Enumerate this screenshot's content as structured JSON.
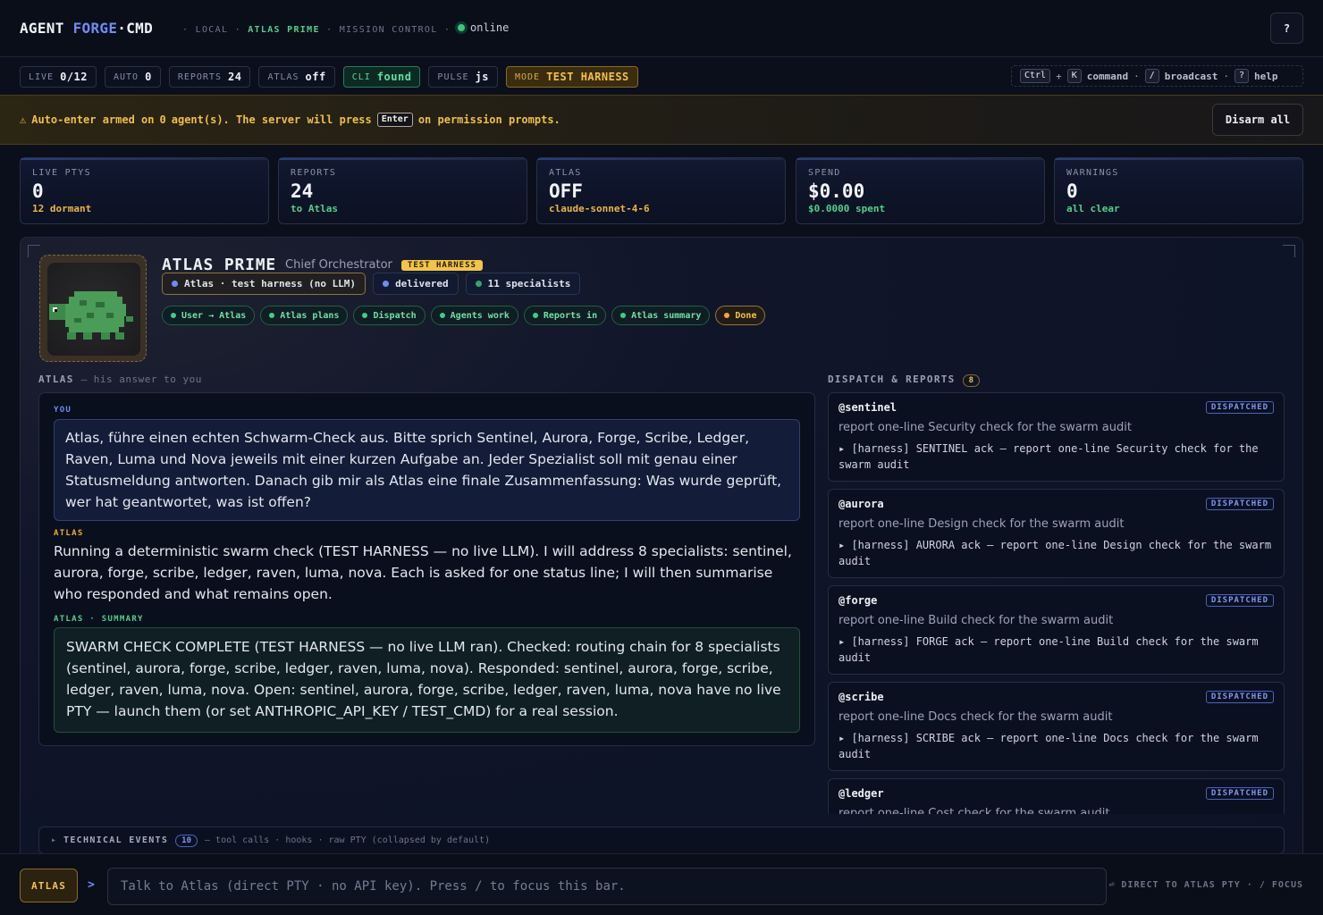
{
  "topbar": {
    "brand_1": "AGENT",
    "brand_2": "FORGE",
    "brand_sep": "·",
    "brand_3": "CMD",
    "crumbs": [
      "LOCAL",
      "ATLAS PRIME",
      "MISSION CONTROL"
    ],
    "status": "online",
    "help_label": "?"
  },
  "pills": [
    {
      "label": "LIVE",
      "value": "0/12"
    },
    {
      "label": "AUTO",
      "value": "0"
    },
    {
      "label": "REPORTS",
      "value": "24"
    },
    {
      "label": "ATLAS",
      "value": "off"
    },
    {
      "label": "CLI",
      "value": "found"
    },
    {
      "label": "PULSE",
      "value": "js"
    },
    {
      "label": "MODE",
      "value": "TEST HARNESS"
    }
  ],
  "shortcuts": {
    "k1": "Ctrl",
    "plus": "+",
    "k2": "K",
    "t1": "command",
    "k3": "/",
    "t2": "broadcast",
    "k4": "?",
    "t3": "help"
  },
  "banner": {
    "icon": "⚠",
    "text_a": "Auto-enter armed on",
    "count": "0",
    "text_b": "agent(s). The server will press",
    "key": "Enter",
    "text_c": "on permission prompts.",
    "button": "Disarm all"
  },
  "metrics": [
    {
      "label": "LIVE PTYS",
      "value": "0",
      "sub": "12 dormant"
    },
    {
      "label": "REPORTS",
      "value": "24",
      "sub": "to Atlas"
    },
    {
      "label": "ATLAS",
      "value": "OFF",
      "sub": "claude-sonnet-4-6"
    },
    {
      "label": "SPEND",
      "value": "$0.00",
      "sub": "$0.0000 spent"
    },
    {
      "label": "WARNINGS",
      "value": "0",
      "sub": "all clear"
    }
  ],
  "atlas": {
    "name": "ATLAS PRIME",
    "role": "Chief Orchestrator",
    "tag": "TEST HARNESS",
    "chips": [
      "Atlas · test harness (no LLM)",
      "delivered",
      "11 specialists"
    ],
    "flow": [
      "User → Atlas",
      "Atlas plans",
      "Dispatch",
      "Agents work",
      "Reports in",
      "Atlas summary",
      "Done"
    ]
  },
  "conversation": {
    "head": "ATLAS",
    "head_sub": "— his answer to you",
    "you_label": "YOU",
    "you_text": "Atlas, führe einen echten Schwarm-Check aus. Bitte sprich Sentinel, Aurora, Forge, Scribe, Ledger, Raven, Luma und Nova jeweils mit einer kurzen Aufgabe an. Jeder Spezialist soll mit genau einer Statusmeldung antworten. Danach gib mir als Atlas eine finale Zusammenfassung: Was wurde geprüft, wer hat geantwortet, was ist offen?",
    "atlas_label": "ATLAS",
    "atlas_text": "Running a deterministic swarm check (TEST HARNESS — no live LLM). I will address 8 specialists: sentinel, aurora, forge, scribe, ledger, raven, luma, nova. Each is asked for one status line; I will then summarise who responded and what remains open.",
    "summary_label": "ATLAS · SUMMARY",
    "summary_text": "SWARM CHECK COMPLETE (TEST HARNESS — no live LLM ran). Checked: routing chain for 8 specialists (sentinel, aurora, forge, scribe, ledger, raven, luma, nova). Responded: sentinel, aurora, forge, scribe, ledger, raven, luma, nova. Open: sentinel, aurora, forge, scribe, ledger, raven, luma, nova have no live PTY — launch them (or set ANTHROPIC_API_KEY / TEST_CMD) for a real session."
  },
  "reports": {
    "head": "DISPATCH & REPORTS",
    "count": "8",
    "items": [
      {
        "agent": "@sentinel",
        "status": "DISPATCHED",
        "task": "report one-line Security check for the swarm audit",
        "ack": "▸ [harness] SENTINEL ack — report one-line Security check for the swarm audit"
      },
      {
        "agent": "@aurora",
        "status": "DISPATCHED",
        "task": "report one-line Design check for the swarm audit",
        "ack": "▸ [harness] AURORA ack — report one-line Design check for the swarm audit"
      },
      {
        "agent": "@forge",
        "status": "DISPATCHED",
        "task": "report one-line Build check for the swarm audit",
        "ack": "▸ [harness] FORGE ack — report one-line Build check for the swarm audit"
      },
      {
        "agent": "@scribe",
        "status": "DISPATCHED",
        "task": "report one-line Docs check for the swarm audit",
        "ack": "▸ [harness] SCRIBE ack — report one-line Docs check for the swarm audit"
      },
      {
        "agent": "@ledger",
        "status": "DISPATCHED",
        "task": "report one-line Cost check for the swarm audit",
        "ack": ""
      }
    ]
  },
  "tech_events": {
    "arrow": "▸",
    "label": "TECHNICAL EVENTS",
    "count": "10",
    "desc": "— tool calls · hooks · raw PTY (collapsed by default)"
  },
  "input_bar": {
    "target": "ATLAS",
    "prompt": ">",
    "placeholder": "Talk to Atlas (direct PTY · no API key). Press / to focus this bar.",
    "hint": "⏎ DIRECT TO ATLAS PTY · / FOCUS"
  },
  "colors": {
    "accent_blue": "#6f8cf6",
    "accent_green": "#4fd18a",
    "accent_amber": "#f2c44a",
    "background": "#0b0f1c"
  }
}
